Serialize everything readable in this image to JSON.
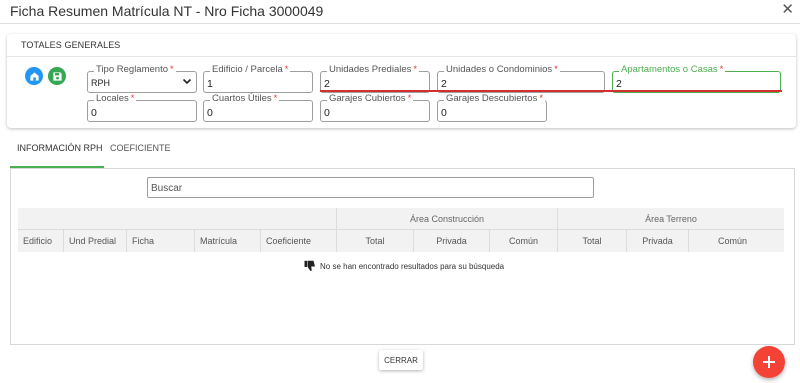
{
  "dialog": {
    "title": "Ficha Resumen Matrícula NT - Nro Ficha 3000049",
    "close_icon": "✕"
  },
  "totales": {
    "title": "TOTALES GENERALES",
    "actions": [
      {
        "icon": "home-icon",
        "color": "#2196f3"
      },
      {
        "icon": "save-icon",
        "color": "#34a853"
      }
    ],
    "fields": {
      "tipo_reglamento": {
        "label": "Tipo Reglamento",
        "value": "RPH"
      },
      "edificio": {
        "label": "Edificio / Parcela",
        "value": "1"
      },
      "unidades_prediales": {
        "label": "Unidades Prediales",
        "value": "2"
      },
      "unidades_condominios": {
        "label": "Unidades o Condominios",
        "value": "2"
      },
      "apartamentos": {
        "label": "Apartamentos o Casas",
        "value": "2"
      },
      "locales": {
        "label": "Locales",
        "value": "0"
      },
      "cuartos_utiles": {
        "label": "Cuartos Útiles",
        "value": "0"
      },
      "garajes_cubiertos": {
        "label": "Garajes Cubiertos",
        "value": "0"
      },
      "garajes_descubiertos": {
        "label": "Garajes Descubiertos",
        "value": "0"
      }
    },
    "required_mark": "*"
  },
  "tabs": [
    {
      "label": "INFORMACIÓN RPH",
      "active": true
    },
    {
      "label": "COEFICIENTE",
      "active": false
    }
  ],
  "search": {
    "placeholder": "Buscar"
  },
  "table": {
    "groups": {
      "construccion": "Área Construcción",
      "terreno": "Área Terreno"
    },
    "columns": [
      "Edificio",
      "Und Predial",
      "Ficha",
      "Matrícula",
      "Coeficiente",
      "Total",
      "Privada",
      "Común",
      "Total",
      "Privada",
      "Común"
    ],
    "empty_message": "No se han encontrado resultados para su búsqueda"
  },
  "footer": {
    "close_label": "CERRAR",
    "fab_icon": "plus-icon"
  },
  "colors": {
    "accent_green": "#4caf50",
    "error_red": "#d32f2f",
    "fab_red": "#f44336",
    "blue": "#2196f3"
  }
}
